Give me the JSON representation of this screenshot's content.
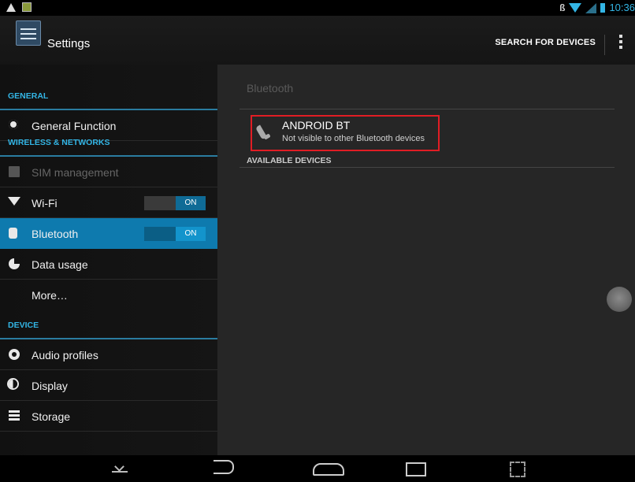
{
  "status_bar": {
    "time": "10:36",
    "bt_glyph": "ß"
  },
  "action_bar": {
    "title": "Settings",
    "search_label": "SEARCH FOR DEVICES"
  },
  "sidebar": {
    "sections": [
      {
        "header": "GENERAL"
      },
      {
        "header": "WIRELESS & NETWORKS"
      },
      {
        "header": "DEVICE"
      }
    ],
    "items": [
      {
        "label": "General Function",
        "icon": "gear-icon"
      },
      {
        "label": "SIM management",
        "icon": "sim-icon",
        "disabled": true
      },
      {
        "label": "Wi-Fi",
        "icon": "wifi-icon",
        "toggle": "ON"
      },
      {
        "label": "Bluetooth",
        "icon": "bluetooth-icon",
        "toggle": "ON",
        "selected": true
      },
      {
        "label": "Data usage",
        "icon": "data-usage-icon"
      },
      {
        "label": "More…"
      },
      {
        "label": "Audio profiles",
        "icon": "audio-profiles-icon"
      },
      {
        "label": "Display",
        "icon": "display-icon"
      },
      {
        "label": "Storage",
        "icon": "storage-icon"
      }
    ]
  },
  "main": {
    "title": "Bluetooth",
    "device": {
      "name": "ANDROID BT",
      "status": "Not visible to other Bluetooth devices",
      "icon": "phone-icon"
    },
    "available_header": "AVAILABLE DEVICES"
  },
  "colors": {
    "accent": "#33b5e5",
    "selected_bg": "#0e7aae",
    "highlight_box": "#e11d24"
  }
}
